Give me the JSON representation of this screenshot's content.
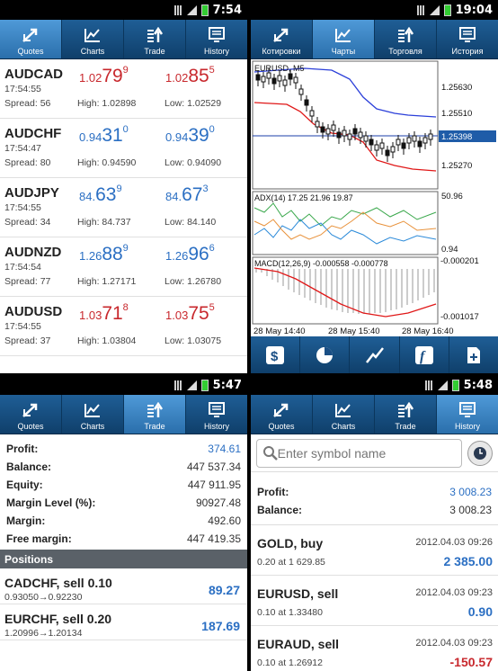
{
  "screens": {
    "quotes": {
      "time": "7:54",
      "tabs": [
        "Quotes",
        "Charts",
        "Trade",
        "History"
      ],
      "rows": [
        {
          "symbol": "AUDCAD",
          "time": "17:54:55",
          "spread": "Spread: 56",
          "high": "High: 1.02898",
          "low": "Low: 1.02529",
          "bid_pre": "1.02",
          "bid_big": "79",
          "bid_sup": "9",
          "ask_pre": "1.02",
          "ask_big": "85",
          "ask_sup": "5",
          "color": "red"
        },
        {
          "symbol": "AUDCHF",
          "time": "17:54:47",
          "spread": "Spread: 80",
          "high": "High: 0.94590",
          "low": "Low: 0.94090",
          "bid_pre": "0.94",
          "bid_big": "31",
          "bid_sup": "0",
          "ask_pre": "0.94",
          "ask_big": "39",
          "ask_sup": "0",
          "color": "blue"
        },
        {
          "symbol": "AUDJPY",
          "time": "17:54:55",
          "spread": "Spread: 34",
          "high": "High: 84.737",
          "low": "Low: 84.140",
          "bid_pre": "84.",
          "bid_big": "63",
          "bid_sup": "9",
          "ask_pre": "84.",
          "ask_big": "67",
          "ask_sup": "3",
          "color": "blue"
        },
        {
          "symbol": "AUDNZD",
          "time": "17:54:54",
          "spread": "Spread: 77",
          "high": "High: 1.27171",
          "low": "Low: 1.26780",
          "bid_pre": "1.26",
          "bid_big": "88",
          "bid_sup": "9",
          "ask_pre": "1.26",
          "ask_big": "96",
          "ask_sup": "6",
          "color": "blue"
        },
        {
          "symbol": "AUDUSD",
          "time": "17:54:55",
          "spread": "Spread: 37",
          "high": "High: 1.03804",
          "low": "Low: 1.03075",
          "bid_pre": "1.03",
          "bid_big": "71",
          "bid_sup": "8",
          "ask_pre": "1.03",
          "ask_big": "75",
          "ask_sup": "5",
          "color": "red"
        }
      ]
    },
    "charts": {
      "time": "19:04",
      "tabs": [
        "Котировки",
        "Чарты",
        "Торговля",
        "История"
      ],
      "symbol_label": "EURUSD, M5",
      "price_ticks": [
        "1.25630",
        "1.25510",
        "1.25398",
        "1.25270"
      ],
      "adx_label": "ADX(14) 17.25 21.96 19.87",
      "adx_ticks": [
        "50.96",
        "0.94"
      ],
      "macd_label": "MACD(12,26,9) -0.000558 -0.000778",
      "macd_ticks": [
        "-0.000201",
        "-0.001017"
      ],
      "time_ticks": [
        "28 May 14:40",
        "28 May 15:40",
        "28 May 16:40"
      ],
      "toolbar": [
        "$",
        "◔",
        "∕",
        "f",
        "+"
      ]
    },
    "trade": {
      "time": "5:47",
      "tabs": [
        "Quotes",
        "Charts",
        "Trade",
        "History"
      ],
      "account": [
        {
          "label": "Profit:",
          "value": "374.61",
          "blue": true
        },
        {
          "label": "Balance:",
          "value": "447 537.34",
          "blue": false
        },
        {
          "label": "Equity:",
          "value": "447 911.95",
          "blue": false
        },
        {
          "label": "Margin Level (%):",
          "value": "90927.48",
          "blue": false
        },
        {
          "label": "Margin:",
          "value": "492.60",
          "blue": false
        },
        {
          "label": "Free margin:",
          "value": "447 419.35",
          "blue": false
        }
      ],
      "positions_header": "Positions",
      "positions": [
        {
          "title": "CADCHF, sell 0.10",
          "sub": "0.93050→0.92230",
          "value": "89.27"
        },
        {
          "title": "EURCHF, sell 0.20",
          "sub": "1.20996→1.20134",
          "value": "187.69"
        }
      ]
    },
    "history": {
      "time": "5:48",
      "tabs": [
        "Quotes",
        "Charts",
        "Trade",
        "History"
      ],
      "search_placeholder": "Enter symbol name",
      "account": [
        {
          "label": "Profit:",
          "value": "3 008.23",
          "blue": true
        },
        {
          "label": "Balance:",
          "value": "3 008.23",
          "blue": false
        }
      ],
      "deals": [
        {
          "title": "GOLD, buy",
          "sub": "0.20 at 1 629.85",
          "date": "2012.04.03 09:26",
          "value": "2 385.00",
          "color": "blue"
        },
        {
          "title": "EURUSD, sell",
          "sub": "0.10 at 1.33480",
          "date": "2012.04.03 09:23",
          "value": "0.90",
          "color": "blue"
        },
        {
          "title": "EURAUD, sell",
          "sub": "0.10 at 1.26912",
          "date": "2012.04.03 09:23",
          "value": "-150.57",
          "color": "red"
        }
      ]
    }
  }
}
